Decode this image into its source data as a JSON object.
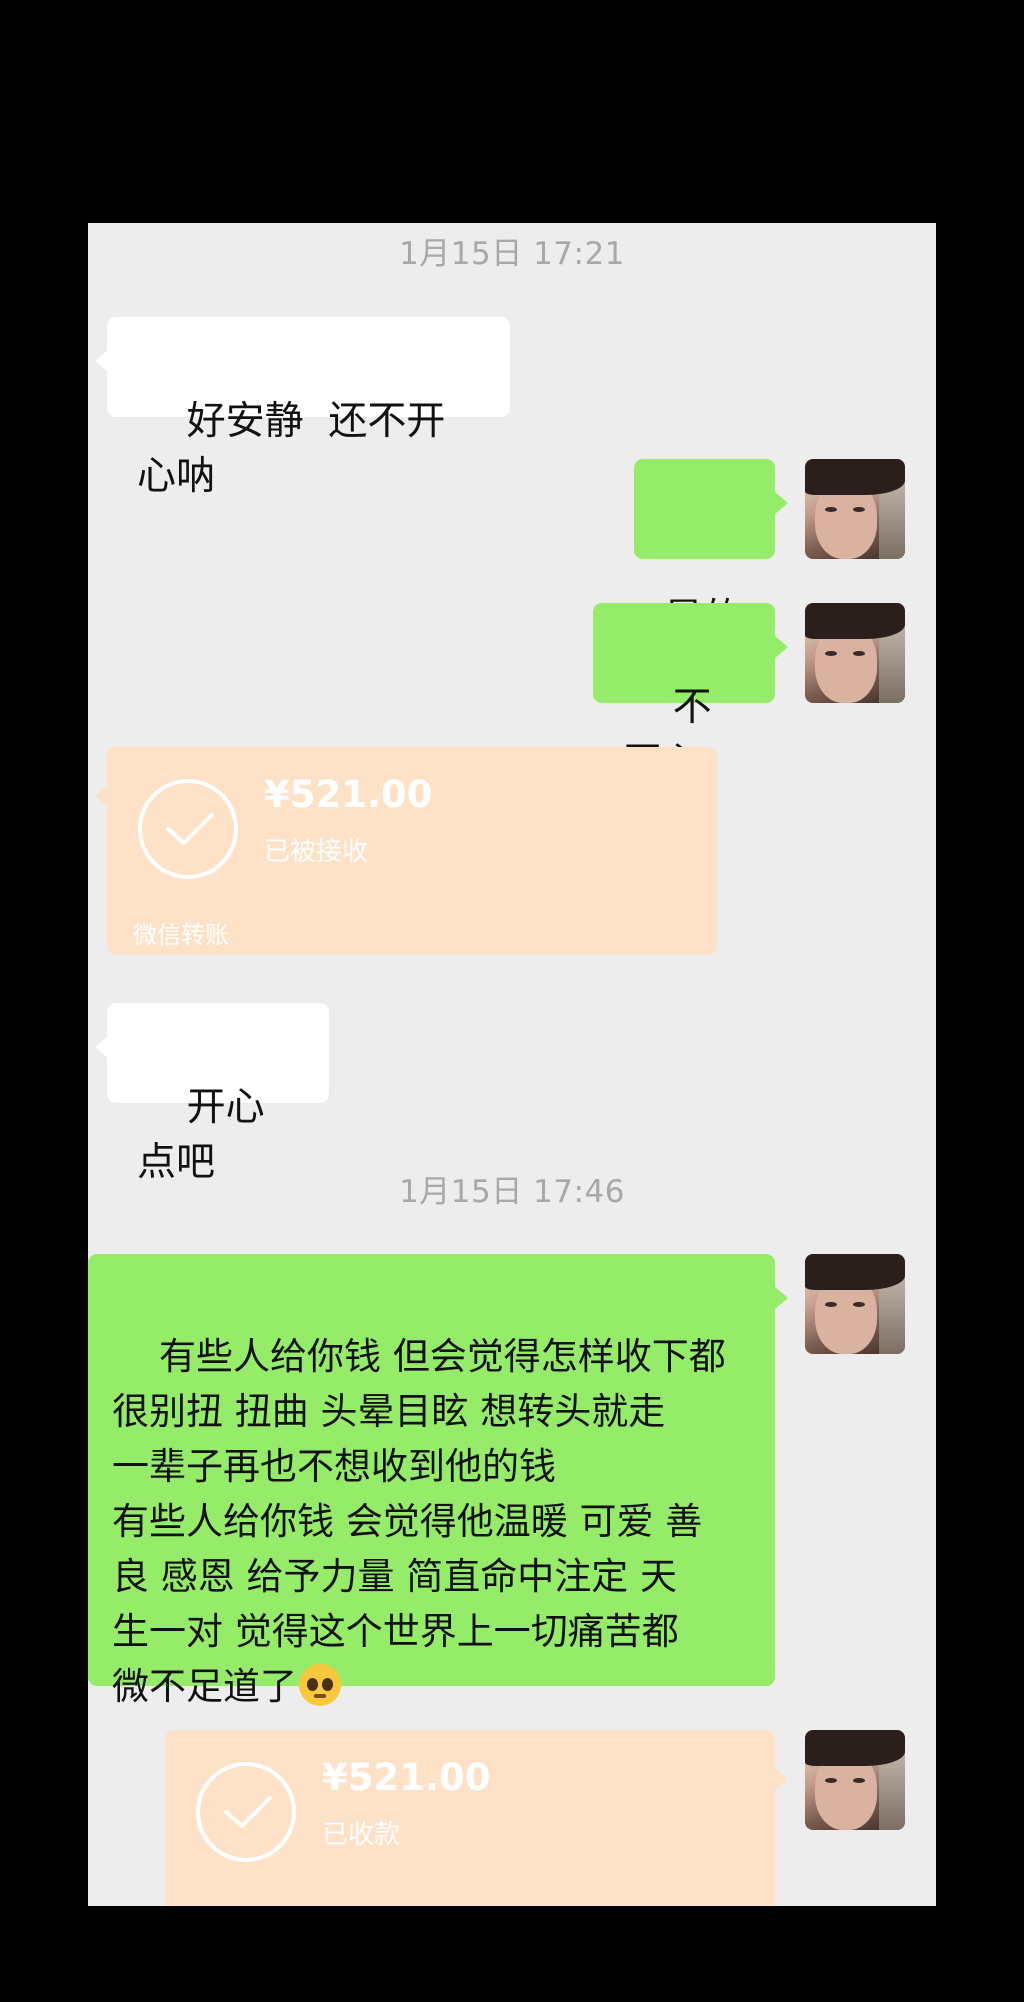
{
  "chat": {
    "timestamp_1": "1月15日 17:21",
    "timestamp_2": "1月15日 17:46",
    "messages": {
      "m1": "好安静  还不开心呐",
      "m2": "是的",
      "m3": "不开心",
      "m5": "开心点吧",
      "m6": "有些人给你钱 但会觉得怎样收下都\n很别扭 扭曲 头晕目眩 想转头就走\n一辈子再也不想收到他的钱\n有些人给你钱 会觉得他温暖 可爱 善\n良 感恩 给予力量 简直命中注定 天\n生一对 觉得这个世界上一切痛苦都\n微不足道了",
      "m6_emoji": "pleading-face-emoji"
    },
    "transfer_1": {
      "amount": "¥521.00",
      "status": "已被接收",
      "brand": "微信转账"
    },
    "transfer_2": {
      "amount": "¥521.00",
      "status": "已收款"
    }
  },
  "colors": {
    "background": "#000000",
    "chat_bg": "#ededed",
    "bubble_self": "#95ec69",
    "bubble_other": "#ffffff",
    "transfer_card": "#fde2c8",
    "timestamp": "#a8a8a8"
  }
}
